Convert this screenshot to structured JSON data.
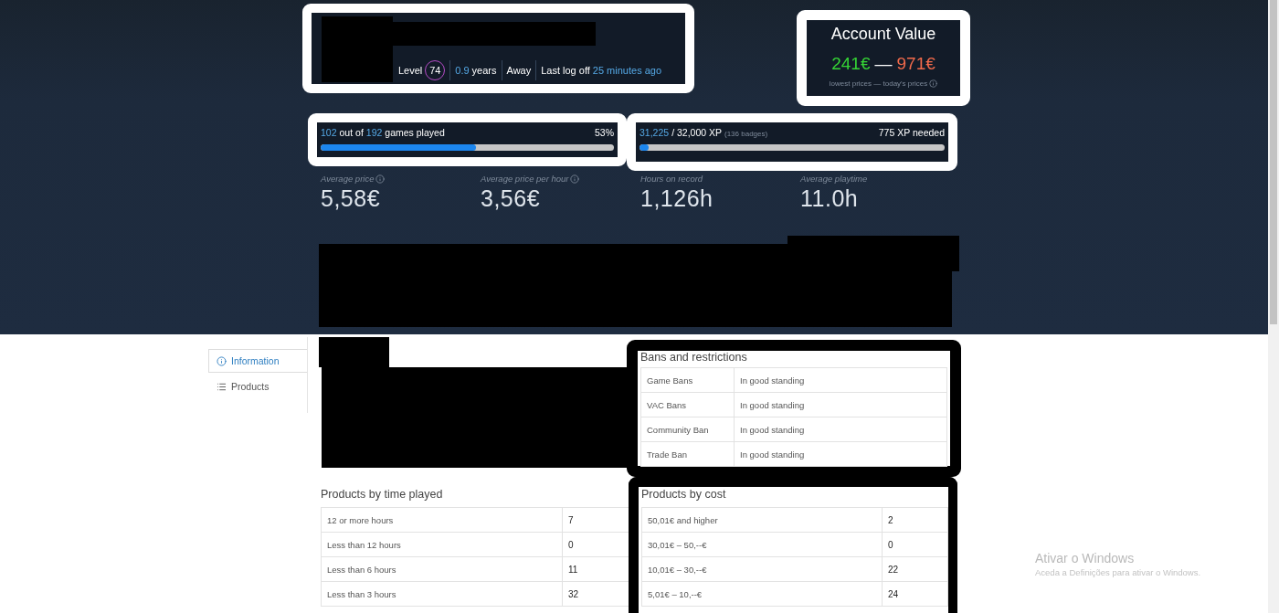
{
  "profile": {
    "level_label": "Level",
    "level": "74",
    "years_value": "0.9",
    "years_label": "years",
    "status": "Away",
    "last_logoff_label": "Last log off",
    "last_logoff_value": "25 minutes ago"
  },
  "account_value": {
    "title": "Account Value",
    "low": "241€",
    "separator": "—",
    "high": "971€",
    "caption": "lowest prices — today's prices"
  },
  "games_progress": {
    "played": "102",
    "connector": "out of",
    "total": "192",
    "label": "games played",
    "percent": "53%",
    "level": 0.53
  },
  "xp_progress": {
    "current": "31,225",
    "target": "/ 32,000 XP",
    "badges": "(136 badges)",
    "needed": "775 XP needed",
    "level": 0.03
  },
  "stats": [
    {
      "label": "Average price",
      "info": true,
      "value": "5,58€"
    },
    {
      "label": "Average price per hour",
      "info": true,
      "value": "3,56€"
    },
    {
      "label": "Hours on record",
      "info": false,
      "value": "1,126h"
    },
    {
      "label": "Average playtime",
      "info": false,
      "value": "11.0h"
    }
  ],
  "sidebar": {
    "tabs": [
      {
        "label": "Information",
        "selected": true
      },
      {
        "label": "Products",
        "selected": false
      }
    ]
  },
  "bans": {
    "title": "Bans and restrictions",
    "rows": [
      {
        "name": "Game Bans",
        "status": "In good standing"
      },
      {
        "name": "VAC Bans",
        "status": "In good standing"
      },
      {
        "name": "Community Ban",
        "status": "In good standing"
      },
      {
        "name": "Trade Ban",
        "status": "In good standing"
      }
    ]
  },
  "products_by_time": {
    "title": "Products by time played",
    "rows": [
      {
        "range": "12 or more hours",
        "count": "7"
      },
      {
        "range": "Less than 12 hours",
        "count": "0"
      },
      {
        "range": "Less than 6 hours",
        "count": "11"
      },
      {
        "range": "Less than 3 hours",
        "count": "32"
      }
    ]
  },
  "products_by_cost": {
    "title": "Products by cost",
    "rows": [
      {
        "range": "50,01€ and higher",
        "count": "2"
      },
      {
        "range": "30,01€ – 50,--€",
        "count": "0"
      },
      {
        "range": "10,01€ – 30,--€",
        "count": "22"
      },
      {
        "range": "5,01€ – 10,--€",
        "count": "24"
      }
    ]
  },
  "os_notice": {
    "title": "Ativar o Windows",
    "message": "Aceda a Definições para ativar o Windows."
  }
}
